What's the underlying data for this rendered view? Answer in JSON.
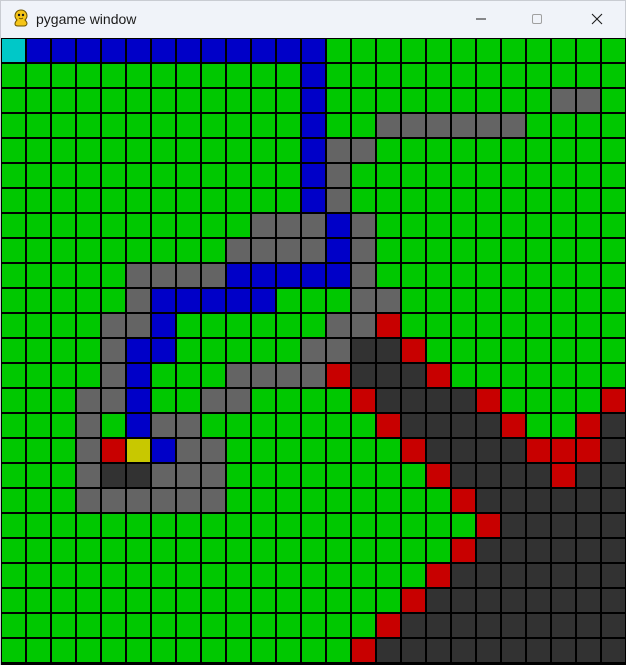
{
  "window": {
    "title": "pygame window",
    "app_icon": "pygame-snake-icon",
    "buttons": [
      "minimize-icon",
      "maximize-icon",
      "close-icon"
    ]
  },
  "legend_colors": {
    "start": "#00c8c8",
    "goal": "#c8c800",
    "path": "#0000c8",
    "open": "#00c800",
    "visited": "#646464",
    "frontier": "#c80000",
    "wall": "#323232",
    "gridline": "#000000"
  },
  "grid": {
    "cols": 25,
    "rows": 25,
    "key": {
      "0": "open",
      "1": "path",
      "2": "visited",
      "3": "frontier",
      "4": "wall",
      "5": "start",
      "6": "goal"
    },
    "cells": [
      "5111111111111000000000000",
      "0000000000001000000000000",
      "0000000000001000000000220",
      "0000000000001002222220000",
      "0000000000001220000000000",
      "0000000000001200000000000",
      "0000000000001200000000000",
      "0000000000222120000000000",
      "0000000002222120000000000",
      "0000022221111120000000000",
      "0000021111100022000000000",
      "0000221000000223000000000",
      "0000211000002244300000000",
      "0000210002222344430000000",
      "0002210022000034444300003",
      "0002012200000003444430034",
      "0002361220000000344443334",
      "0002442220000000034444344",
      "0002222220000000003444444",
      "0000000000000000000344444",
      "0000000000000000003444444",
      "0000000000000000034444444",
      "0000000000000000344444444",
      "0000000000000003444444444",
      "0000000000000034444444444"
    ]
  }
}
